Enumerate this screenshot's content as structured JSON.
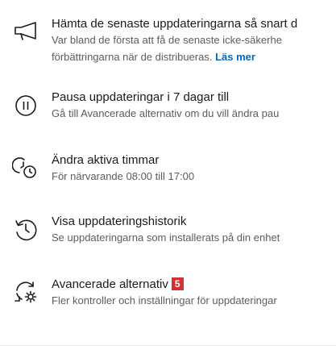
{
  "items": [
    {
      "icon": "megaphone-icon",
      "title": "Hämta de senaste uppdateringarna så snart d",
      "sub1": "Var bland de första att få de senaste icke-säkerhe",
      "sub2": "förbättringarna när de distribueras.",
      "link": "Läs mer"
    },
    {
      "icon": "pause-icon",
      "title": "Pausa uppdateringar i 7 dagar till",
      "sub": "Gå till Avancerade alternativ om du vill ändra pau"
    },
    {
      "icon": "active-hours-icon",
      "title": "Ändra aktiva timmar",
      "sub": "För närvarande 08:00 till 17:00"
    },
    {
      "icon": "history-icon",
      "title": "Visa uppdateringshistorik",
      "sub": "Se uppdateringarna som installerats på din enhet"
    },
    {
      "icon": "advanced-options-icon",
      "title": "Avancerade alternativ",
      "badge": "5",
      "sub": "Fler kontroller och inställningar för uppdateringar"
    }
  ],
  "colors": {
    "link": "#0067c0",
    "badge": "#d83030",
    "title": "#1a1a1a",
    "subtext": "#5c5c5c"
  }
}
